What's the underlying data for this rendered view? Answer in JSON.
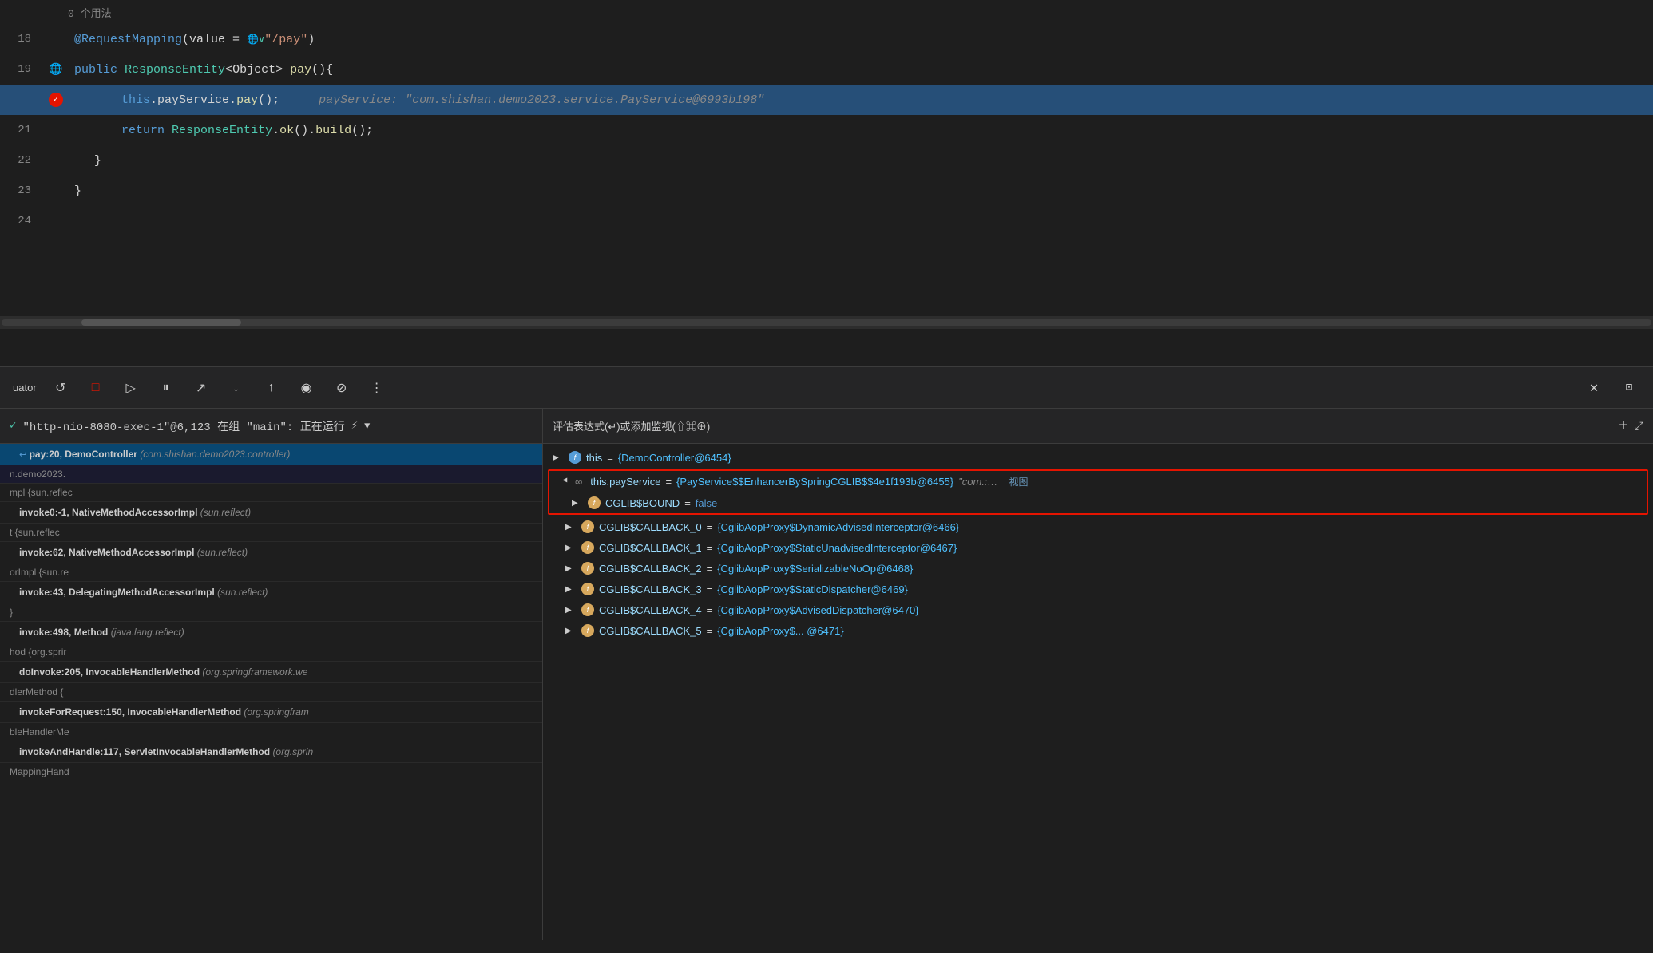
{
  "editor": {
    "usage_hint": "0 个用法",
    "lines": [
      {
        "number": "18",
        "gutter": "none",
        "content_html": "<span class='annotation'>@RequestMapping</span><span>(value = </span><span class='globe-icon'>🌐</span><span class='string'>\"/ pay\"</span><span>)</span>",
        "highlight": false
      },
      {
        "number": "19",
        "gutter": "globe",
        "content_html": "<span class='kw'>public</span> <span class='type'>ResponseEntity</span><span>&lt;Object&gt;</span> <span class='method'>pay</span>(){",
        "highlight": false
      },
      {
        "number": "20",
        "gutter": "breakpoint",
        "content_html": "<span style='padding-left:60px'></span><span class='kw'>this</span>.payService.<span class='method'>pay</span>();   <span class='debug-value'>payService: \"com.shishan.demo2023.service.PayService@6993b198\"</span>",
        "highlight": true
      },
      {
        "number": "21",
        "gutter": "none",
        "content_html": "<span style='padding-left:60px'></span><span class='kw'>return</span> <span class='type'>ResponseEntity</span>.<span class='method'>ok</span>().<span class='method'>build</span>();",
        "highlight": false
      },
      {
        "number": "22",
        "gutter": "none",
        "content_html": "<span style='padding-left:28px'>}</span>",
        "highlight": false
      },
      {
        "number": "23",
        "gutter": "none",
        "content_html": "}",
        "highlight": false
      },
      {
        "number": "24",
        "gutter": "none",
        "content_html": "",
        "highlight": false
      }
    ]
  },
  "debug_toolbar": {
    "label": "uator",
    "buttons": [
      {
        "icon": "↺",
        "name": "rerun",
        "title": "重新运行"
      },
      {
        "icon": "□",
        "name": "stop",
        "title": "停止"
      },
      {
        "icon": "▷",
        "name": "resume",
        "title": "恢复"
      },
      {
        "icon": "⏸",
        "name": "pause",
        "title": "暂停"
      },
      {
        "icon": "↗",
        "name": "step-over",
        "title": "步过"
      },
      {
        "icon": "↓",
        "name": "step-into",
        "title": "步入"
      },
      {
        "icon": "↑",
        "name": "step-out",
        "title": "步出"
      },
      {
        "icon": "◉",
        "name": "view-breakpoints",
        "title": "查看断点"
      },
      {
        "icon": "⊘",
        "name": "mute-breakpoints",
        "title": "静音断点"
      },
      {
        "icon": "⋮",
        "name": "more-options",
        "title": "更多"
      }
    ]
  },
  "threads_panel": {
    "thread_name": "\"http-nio-8080-exec-1\"@6,123 在组 \"main\": 正在运行",
    "check_icon": "✓",
    "filter_icon": "⚡",
    "dropdown_icon": "▼"
  },
  "frames": [
    {
      "method": "pay:20, DemoController",
      "class": "(com.shishan.demo2023.controller)",
      "selected": true
    },
    {
      "method": "invoke0:-1, NativeMethodAccessorImpl",
      "class": "(sun.reflect)",
      "selected": false
    },
    {
      "method": "invoke:62, NativeMethodAccessorImpl",
      "class": "(sun.reflect)",
      "selected": false
    },
    {
      "method": "invoke:43, DelegatingMethodAccessorImpl",
      "class": "(sun.reflect)",
      "selected": false
    },
    {
      "method": "invoke:498, Method",
      "class": "(java.lang.reflect)",
      "selected": false
    },
    {
      "method": "doInvoke:205, InvocableHandlerMethod",
      "class": "(org.springframework.w",
      "selected": false
    },
    {
      "method": "invokeForRequest:150, InvocableHandlerMethod",
      "class": "(org.springfram",
      "selected": false
    },
    {
      "method": "invokeAndHandle:117, ServletInvocableHandlerMethod",
      "class": "(org.sprin",
      "selected": false
    },
    {
      "method": "MappingHand...",
      "class": "",
      "selected": false
    }
  ],
  "left_panel_items": [
    {
      "text": "n.demo2023.",
      "indent": false
    },
    {
      "text": "mpl {sun.reflec",
      "indent": false
    },
    {
      "text": "t {sun.reflec",
      "indent": false
    },
    {
      "text": "orImpl {sun.re",
      "indent": false
    },
    {
      "text": "}",
      "indent": false
    },
    {
      "text": "hod {org.sprir",
      "indent": false
    },
    {
      "text": "dlerMethod {",
      "indent": false
    },
    {
      "text": "bleHandlerMe",
      "indent": false
    },
    {
      "text": "MappingHand",
      "indent": false
    }
  ],
  "eval_header": {
    "label": "评估表达式(↵)或添加监视(⇧⌘⊕)",
    "add_icon": "+",
    "expand_icon": "⤢"
  },
  "variables": [
    {
      "id": "this",
      "indent": 0,
      "expanded": false,
      "icon_type": "field",
      "name": "this",
      "value": "{DemoController@6454}",
      "extra": "",
      "in_red_box": false
    },
    {
      "id": "this.payService",
      "indent": 0,
      "expanded": true,
      "icon_type": "chain",
      "name": "this.payService",
      "value": "{PayService$$EnhancerBySpringCGLIB$$4e1f193b@6455}",
      "extra": "\"com.:… 视图",
      "in_red_box": true
    },
    {
      "id": "CGLIB_BOUND",
      "indent": 1,
      "expanded": false,
      "icon_type": "field-orange",
      "name": "CGLIB$BOUND",
      "value": "false",
      "extra": "",
      "in_red_box": true
    },
    {
      "id": "CGLIB_CALLBACK_0",
      "indent": 1,
      "expanded": false,
      "icon_type": "field-orange",
      "name": "CGLIB$CALLBACK_0",
      "value": "{CglibAopProxy$DynamicAdvisedInterceptor@6466}",
      "extra": "",
      "in_red_box": false
    },
    {
      "id": "CGLIB_CALLBACK_1",
      "indent": 1,
      "expanded": false,
      "icon_type": "field-orange",
      "name": "CGLIB$CALLBACK_1",
      "value": "{CglibAopProxy$StaticUnadvisedInterceptor@6467}",
      "extra": "",
      "in_red_box": false
    },
    {
      "id": "CGLIB_CALLBACK_2",
      "indent": 1,
      "expanded": false,
      "icon_type": "field-orange",
      "name": "CGLIB$CALLBACK_2",
      "value": "{CglibAopProxy$SerializableNoOp@6468}",
      "extra": "",
      "in_red_box": false
    },
    {
      "id": "CGLIB_CALLBACK_3",
      "indent": 1,
      "expanded": false,
      "icon_type": "field-orange",
      "name": "CGLIB$CALLBACK_3",
      "value": "{CglibAopProxy$StaticDispatcher@6469}",
      "extra": "",
      "in_red_box": false
    },
    {
      "id": "CGLIB_CALLBACK_4",
      "indent": 1,
      "expanded": false,
      "icon_type": "field-orange",
      "name": "CGLIB$CALLBACK_4",
      "value": "{CglibAopProxy$AdvisedDispatcher@6470}",
      "extra": "",
      "in_red_box": false
    },
    {
      "id": "CGLIB_CALLBACK_5",
      "indent": 1,
      "expanded": false,
      "icon_type": "field-orange",
      "name": "CGLIB$CALLBACK_5",
      "value": "{CglibAopProxy$... @6471}",
      "extra": "",
      "in_red_box": false
    }
  ]
}
